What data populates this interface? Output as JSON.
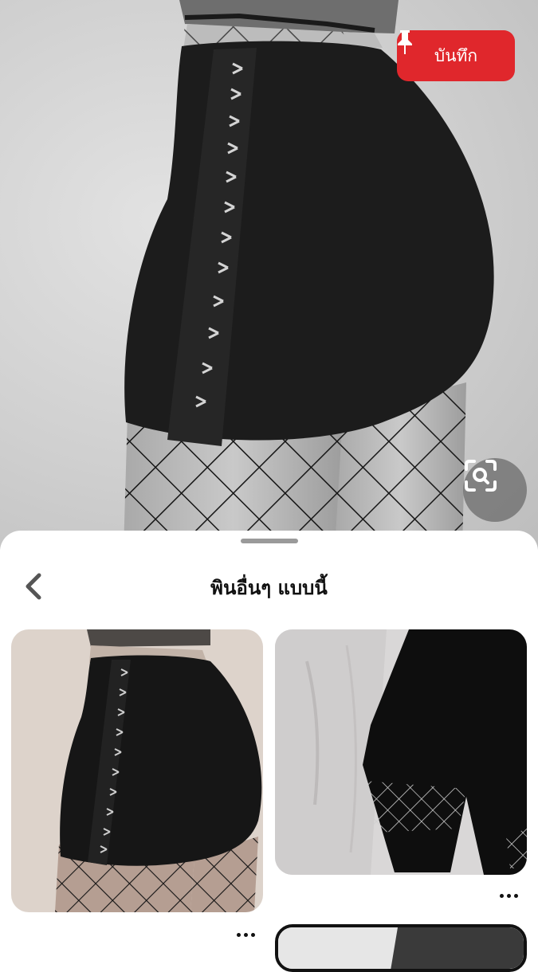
{
  "pin": {
    "save_label": "บันทึก",
    "save_icon": "pushpin-icon",
    "visual_search_icon": "visual-search-icon",
    "accent_color": "#e0272c"
  },
  "related": {
    "title": "พินอื่นๆ แบบนี้",
    "back_icon": "chevron-left-icon",
    "cards": [
      {
        "kind": "image",
        "more_icon": "more-options-icon"
      },
      {
        "kind": "image",
        "more_icon": "more-options-icon"
      },
      {
        "kind": "image",
        "more_icon": "more-options-icon"
      }
    ]
  }
}
